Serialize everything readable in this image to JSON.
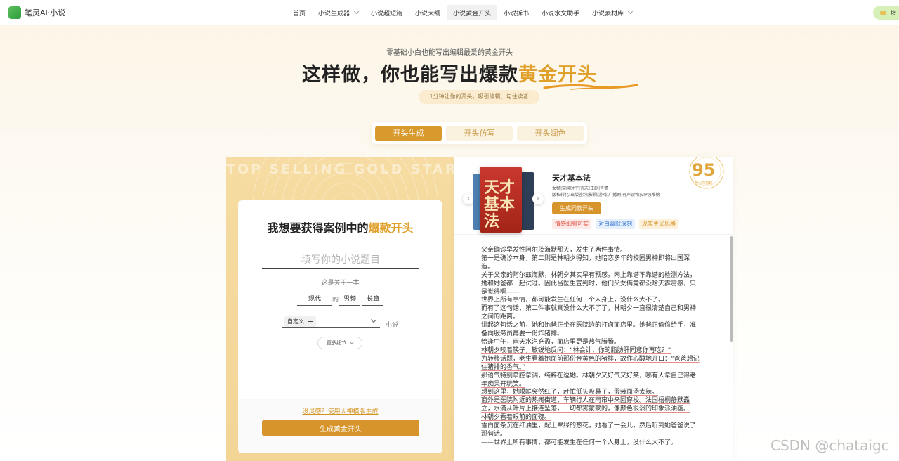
{
  "nav": {
    "brand": "笔灵AI·小说",
    "items": [
      {
        "label": "首页",
        "dropdown": false,
        "active": false
      },
      {
        "label": "小说生成器",
        "dropdown": true,
        "active": false
      },
      {
        "label": "小说超短篇",
        "dropdown": false,
        "active": false
      },
      {
        "label": "小说大纲",
        "dropdown": false,
        "active": false
      },
      {
        "label": "小说黄金开头",
        "dropdown": false,
        "active": true
      },
      {
        "label": "小说拆书",
        "dropdown": false,
        "active": false
      },
      {
        "label": "小说水文助手",
        "dropdown": false,
        "active": false
      },
      {
        "label": "小说素材库",
        "dropdown": true,
        "active": false
      }
    ],
    "user_pill": "增"
  },
  "hero": {
    "subtitle": "零基础小白也能写出编辑最爱的黄金开头",
    "title_plain": "这样做，你也能写出爆款",
    "title_gold": "黄金开头",
    "tagline": "1分钟让你的开头，吸引编辑、勾住读者"
  },
  "tabs": [
    {
      "label": "开头生成",
      "active": true
    },
    {
      "label": "开头仿写",
      "active": false
    },
    {
      "label": "开头润色",
      "active": false
    }
  ],
  "left": {
    "watermark": "TOP SELLING GOLD START",
    "form_title_plain": "我想要获得案例中的",
    "form_title_gold": "爆款开头",
    "input_placeholder": "填写你的小说题目",
    "about_label": "这是关于一本",
    "option_era": "现代",
    "de": "的",
    "option_channel": "男频",
    "option_length": "长篇",
    "custom_chip": "自定义",
    "novel_suffix": "小说",
    "more_details": "更多细节",
    "template_link": "没灵感？使用大神模版生成",
    "generate_button": "生成黄金开头"
  },
  "right": {
    "book_title": "天才基本法",
    "book_tags": "女频|穿越时空|言志|正剧|言情",
    "book_desc": "版权转化:出版签约|影视|游戏|广播剧|有声读物|VIP强推榜",
    "gen_same_button": "生成同款开头",
    "tags": [
      {
        "label": "情感细腻可实",
        "color": "#e0564b",
        "bg": "#fde9e7"
      },
      {
        "label": "对白幽默深刻",
        "color": "#3a78d6",
        "bg": "#e6f0fc"
      },
      {
        "label": "现实主义风格",
        "color": "#d6942a",
        "bg": "#fdf1dc"
      }
    ],
    "score": "95",
    "score_label": "吸引力指数",
    "cover_text": "天才基本法",
    "paragraphs": [
      {
        "text": "父亲确诊早发性阿尔茨海默那天，发生了两件事情。",
        "hl": false
      },
      {
        "text": "第一是确诊本身，第二则是林朝夕得知，她暗恋多年的校园男神即将出国深造。",
        "hl": false
      },
      {
        "text": "关于父亲的阿尔兹海默，林朝夕其实早有预感。网上靠谱不靠谱的检测方法，她和她爸都一起试过。因此当医生宣判时，他们父女俩竟都没啥天霹雳感，只是觉得啊——",
        "hl": false
      },
      {
        "text": "世界上所有事情，都可能发生在任何一个人身上，没什么大不了。",
        "hl": false
      },
      {
        "text": "而有了这句话，第二件事就真没什么大不了了，林朝夕一直很清楚自己和男神之间的距离。",
        "hl": false
      },
      {
        "text": "讲起这句话之前，她和她爸正坐在医院边的打卤面店里。她爸正偷偷给手，准备向服务员再要一份炸猪排。",
        "hl": false
      },
      {
        "text": "恰逢中午，雨天水汽充盈，面店里更是热气腾腾。",
        "hl": false
      },
      {
        "text": "林朝夕咬着筷子，敏锐地反问：“林会计，你的脂肪肝同意你再吃？”",
        "hl": true
      },
      {
        "text": "为转移话题，老生看着她面前那份金黄色的猪排，故作心酸地开口：“爸爸想记住猪排的香气。”",
        "hl": true
      },
      {
        "text": "那语气特别拿腔拿调，纯粹在逗她。林朝夕又好气又好笑，哪有人拿自己得老年痴呆开玩笑。",
        "hl": true
      },
      {
        "text": "想到这里，她眼眶突然红了，赶忙低头吸鼻子，假装面汤太辣。",
        "hl": true
      },
      {
        "text": "窗外是医院附近的热闹街道，车辆行人在雨帘中来回穿梭。法国梧桐静默矗立，水滴从叶片上接连坠落，一切都雾蒙蒙的，像颜色很淡的印象派油画。",
        "hl": true
      },
      {
        "text": "林朝夕看着眼前的面碗。",
        "hl": true
      },
      {
        "text": "雪白面条沉在红油里，配上翠绿的葱花，她看了一会儿，然后听到她爸爸说了那句话。",
        "hl": false
      },
      {
        "text": "——世界上所有事情，都可能发生在任何一个人身上，没什么大不了。",
        "hl": false
      }
    ]
  },
  "watermark_csdn": "CSDN @chataigc"
}
